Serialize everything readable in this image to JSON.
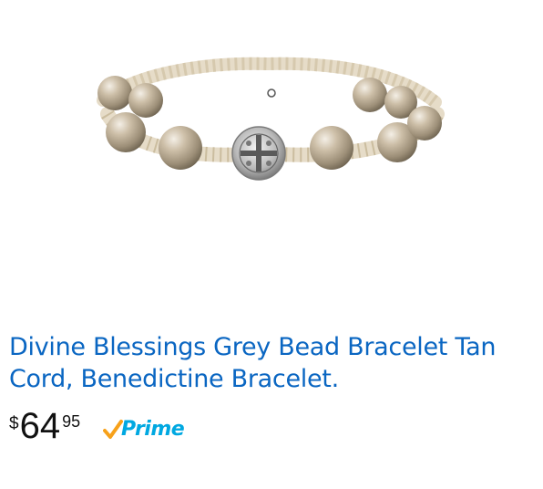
{
  "product": {
    "image_alt": "Divine Blessings Grey Bead Bracelet Tan Cord with Benedictine medal",
    "title": "Divine Blessings Grey Bead Bracelet Tan Cord, Benedictine Bracelet.",
    "price": {
      "currency": "$",
      "whole": "64",
      "fraction": "95"
    },
    "prime_label": "Prime"
  },
  "colors": {
    "title_link": "#0a66c2",
    "prime_blue": "#00a8e1",
    "prime_check": "#f7a11a",
    "price_text": "#111111"
  }
}
